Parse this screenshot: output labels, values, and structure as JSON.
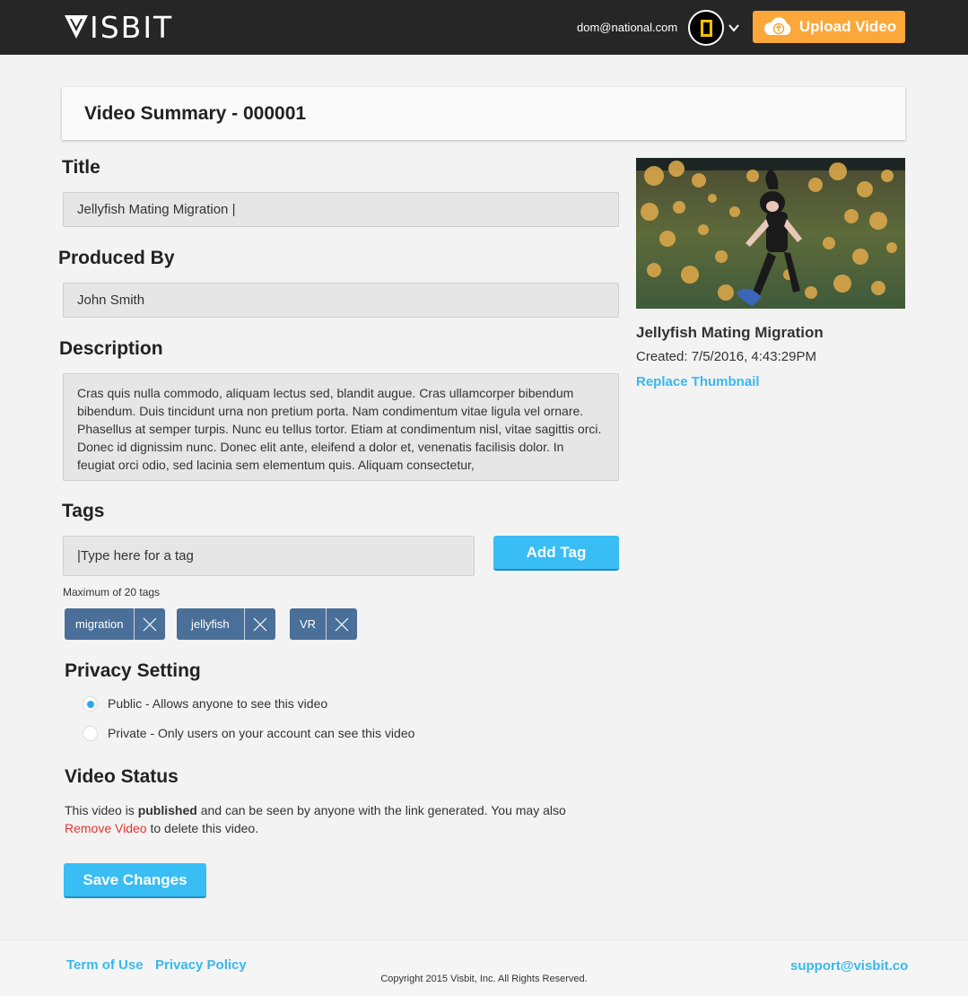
{
  "header": {
    "logo_text": "ISBIT",
    "user_email": "dom@national.com",
    "upload_label": "Upload Video"
  },
  "summary": {
    "title": "Video Summary - 000001"
  },
  "form": {
    "title_label": "Title",
    "title_value": "Jellyfish Mating Migration |",
    "produced_label": "Produced By",
    "produced_value": "John Smith",
    "description_label": "Description",
    "description_value": "Cras quis nulla commodo, aliquam lectus sed, blandit augue. Cras ullamcorper bibendum bibendum. Duis tincidunt urna non pretium porta. Nam condimentum vitae ligula vel ornare. Phasellus at semper turpis. Nunc eu tellus tortor. Etiam at condimentum nisl, vitae sagittis orci. Donec id dignissim nunc. Donec elit ante, eleifend a dolor et, venenatis facilisis dolor. In feugiat orci odio, sed lacinia sem elementum quis. Aliquam consectetur,",
    "tags_label": "Tags",
    "tag_input_placeholder": "|Type here for a tag",
    "add_tag_label": "Add Tag",
    "tag_note": "Maximum of 20 tags",
    "tags": [
      "migration",
      "jellyfish",
      "VR"
    ]
  },
  "privacy": {
    "title": "Privacy Setting",
    "options": [
      {
        "label": "Public - Allows anyone to see this video",
        "selected": true
      },
      {
        "label": "Private - Only users on your account can see this video",
        "selected": false
      }
    ]
  },
  "status": {
    "title": "Video Status",
    "text_before": "This video is ",
    "state": "published",
    "text_middle": " and can be seen by anyone with the link generated. You may also ",
    "remove_label": "Remove Video",
    "text_after": " to delete this video."
  },
  "save_label": "Save Changes",
  "sidebar": {
    "video_name": "Jellyfish Mating Migration",
    "created": "Created: 7/5/2016, 4:43:29PM",
    "replace_label": "Replace Thumbnail"
  },
  "footer": {
    "terms": "Term of Use",
    "privacy": "Privacy Policy",
    "copyright": "Copyright 2015 Visbit, Inc. All Rights Reserved.",
    "support": "support@visbit.co"
  },
  "colors": {
    "accent_blue": "#38bdf5",
    "upload_orange": "#fba739",
    "tag_blue": "#4a6f99",
    "remove_red": "#e5322d",
    "topbar": "#262626"
  },
  "icons": [
    "visbit-logo-icon",
    "avatar-icon",
    "chevron-down-icon",
    "upload-cloud-icon",
    "close-icon",
    "radio-icon"
  ]
}
